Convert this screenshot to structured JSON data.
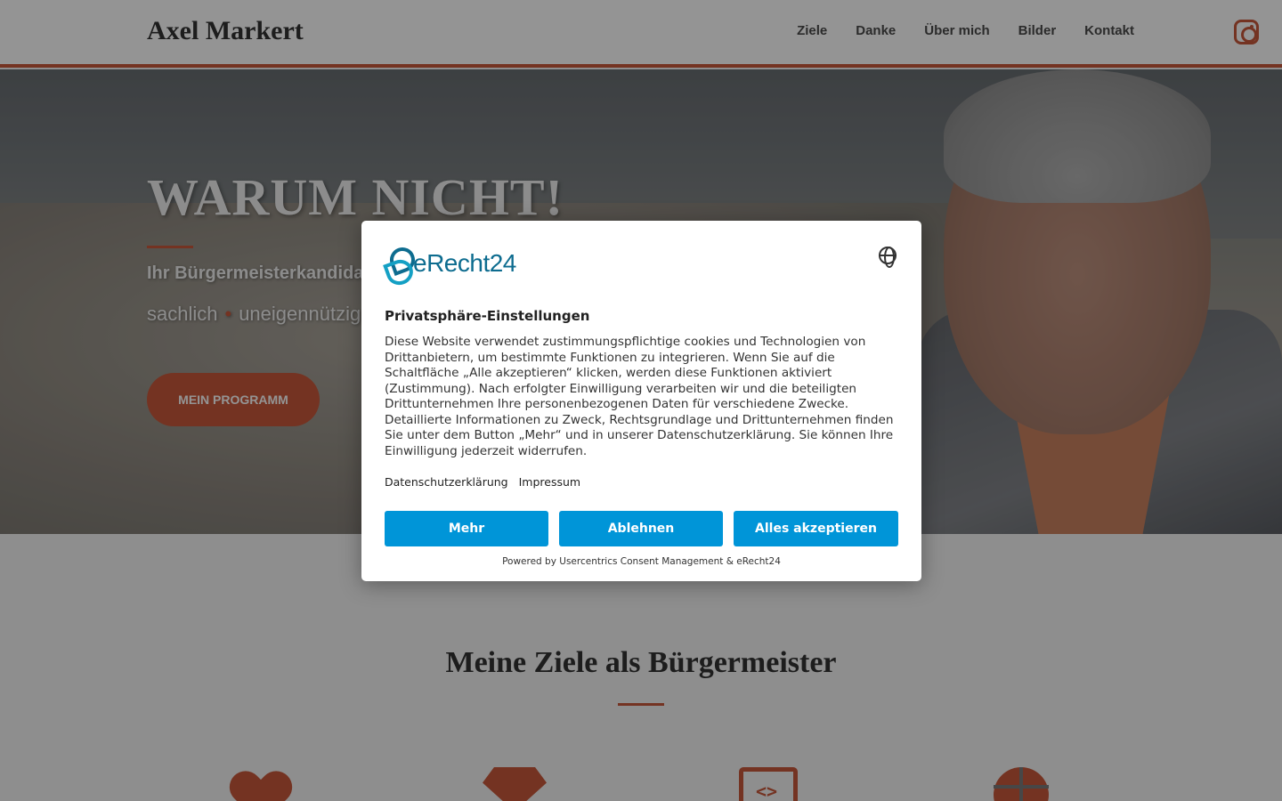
{
  "header": {
    "brand": "Axel Markert",
    "nav": [
      "Ziele",
      "Danke",
      "Über mich",
      "Bilder",
      "Kontakt"
    ],
    "social_icon": "instagram-icon"
  },
  "hero": {
    "title": "WARUM NICHT!",
    "subtitle": "Ihr Bürgermeisterkandidat f",
    "tags": [
      "sachlich",
      "uneigennützig"
    ],
    "cta": "MEIN PROGRAMM"
  },
  "goals": {
    "title": "Meine Ziele als Bürgermeister",
    "icons": [
      "heart-icon",
      "diamond-icon",
      "code-icon",
      "globe-icon"
    ],
    "code_glyph": "<>"
  },
  "consent": {
    "logo_text": "eRecht24",
    "language_icon": "globe-icon",
    "title": "Privatsphäre-Einstellungen",
    "body": "Diese Website verwendet zustimmungspflichtige cookies und Technologien von Drittanbietern, um bestimmte Funktionen zu integrieren. Wenn Sie auf die Schaltfläche „Alle akzeptieren“ klicken, werden diese Funktionen aktiviert (Zustimmung). Nach erfolgter Einwilligung verarbeiten wir und die beteiligten Drittunternehmen Ihre personenbezogenen Daten für verschiedene Zwecke. Detaillierte Informationen zu Zweck, Rechtsgrundlage und Drittunternehmen finden Sie unter dem Button „Mehr“ und in unserer Datenschutzerklärung. Sie können Ihre Einwilligung jederzeit widerrufen.",
    "links": [
      "Datenschutzerklärung",
      "Impressum"
    ],
    "buttons": {
      "more": "Mehr",
      "deny": "Ablehnen",
      "accept": "Alles akzeptieren"
    },
    "powered_by": "Powered by Usercentrics Consent Management & eRecht24"
  },
  "colors": {
    "accent": "#c8593b",
    "consent_button": "#0095d8",
    "logo": "#0d6c8f"
  }
}
